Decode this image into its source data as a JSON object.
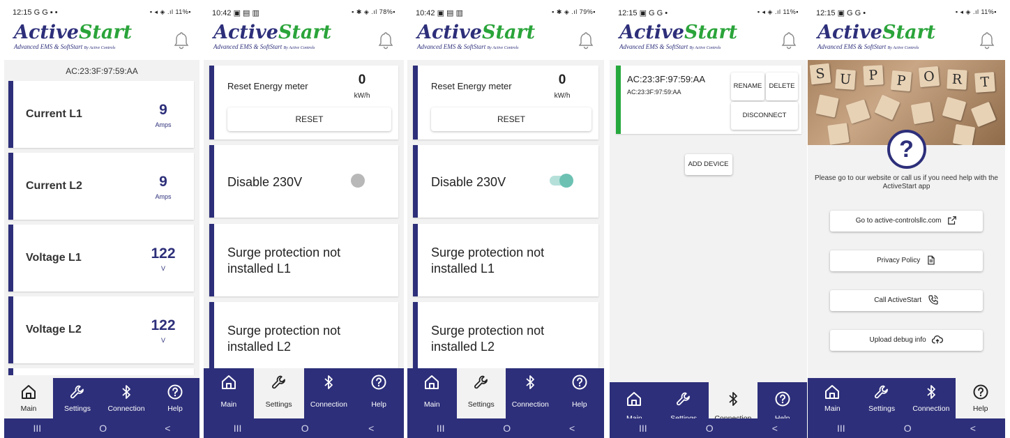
{
  "brand": {
    "word1": "Active",
    "word2": "Start",
    "subtitle": "Advanced EMS & SoftStart",
    "by": "By Active Controls"
  },
  "nav_labels": [
    "Main",
    "Settings",
    "Connection",
    "Help"
  ],
  "icons": {
    "nav": [
      "home-icon",
      "wrench-icon",
      "bluetooth-icon",
      "help-icon"
    ],
    "bell": "bell-icon"
  },
  "colors": {
    "primary": "#2d2f7a",
    "accent_green": "#2aa43a",
    "connected": "#25a93d",
    "toggle_on": "#6cc1b3"
  },
  "sysnav": {
    "recents": "III",
    "home": "O",
    "back": "<"
  },
  "screens": {
    "main": {
      "status_time": "12:15",
      "status_icons": "G G ▪ •",
      "status_right": "▪ ◂ ◈ .ıl 11%▪",
      "mac": "AC:23:3F:97:59:AA",
      "cards": [
        {
          "label": "Current L1",
          "value": "9",
          "unit": "Amps"
        },
        {
          "label": "Current L2",
          "value": "9",
          "unit": "Amps"
        },
        {
          "label": "Voltage L1",
          "value": "122",
          "unit": "V"
        },
        {
          "label": "Voltage L2",
          "value": "122",
          "unit": "V"
        }
      ]
    },
    "settings_off": {
      "status_time": "10:42",
      "status_icons": "▣ ▤ ▥",
      "status_right": "▪ ✱ ◈ .ıl 78%▪",
      "reset_label": "Reset Energy meter",
      "energy_value": "0",
      "energy_unit": "kW/h",
      "reset_button": "RESET",
      "disable_label": "Disable 230V",
      "disable_on": false,
      "surge_l1": "Surge protection not installed L1",
      "surge_l2": "Surge protection not installed L2"
    },
    "settings_on": {
      "status_time": "10:42",
      "status_icons": "▣ ▤ ▥",
      "status_right": "▪ ✱ ◈ .ıl 79%▪",
      "reset_label": "Reset Energy meter",
      "energy_value": "0",
      "energy_unit": "kW/h",
      "reset_button": "RESET",
      "disable_label": "Disable 230V",
      "disable_on": true,
      "surge_l1": "Surge protection not installed L1",
      "surge_l2": "Surge protection not installed L2"
    },
    "connection": {
      "status_time": "12:15",
      "status_icons": "▣ G G •",
      "status_right": "▪ ◂ ◈ .ıl 11%▪",
      "device_name": "AC:23:3F:97:59:AA",
      "device_mac": "AC:23:3F:97:59:AA",
      "rename": "RENAME",
      "delete": "DELETE",
      "disconnect": "DISCONNECT",
      "add_device": "ADD DEVICE"
    },
    "help": {
      "status_time": "12:15",
      "status_icons": "▣ G G •",
      "status_right": "▪ ◂ ◈ .ıl 11%▪",
      "hero_letters": [
        "S",
        "U",
        "P",
        "P",
        "O",
        "R",
        "T"
      ],
      "help_symbol": "?",
      "text": "Please go to our website or call us if you need help with the ActiveStart app",
      "buttons": [
        {
          "label": "Go to active-controlsllc.com",
          "icon": "external-link-icon"
        },
        {
          "label": "Privacy Policy",
          "icon": "document-icon"
        },
        {
          "label": "Call ActiveStart",
          "icon": "phone-call-icon"
        },
        {
          "label": "Upload debug info",
          "icon": "cloud-upload-icon"
        }
      ]
    }
  }
}
